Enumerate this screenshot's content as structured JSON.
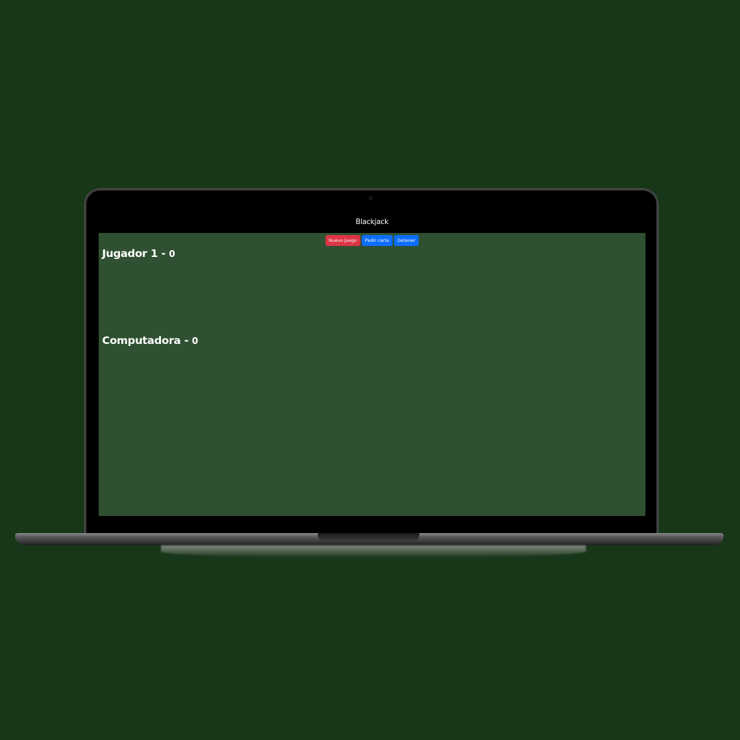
{
  "app": {
    "title": "Blackjack"
  },
  "controls": {
    "new_game_label": "Nuevo Juego",
    "hit_label": "Pedir carta",
    "stand_label": "Detener"
  },
  "players": [
    {
      "name": "Jugador 1",
      "separator": " - ",
      "score": "0"
    },
    {
      "name": "Computadora",
      "separator": " - ",
      "score": "0"
    }
  ],
  "colors": {
    "page_background": "#183718",
    "table_green": "#2f5031",
    "navbar": "#000000",
    "danger_button": "#dc3545",
    "primary_button": "#0d6efd"
  }
}
